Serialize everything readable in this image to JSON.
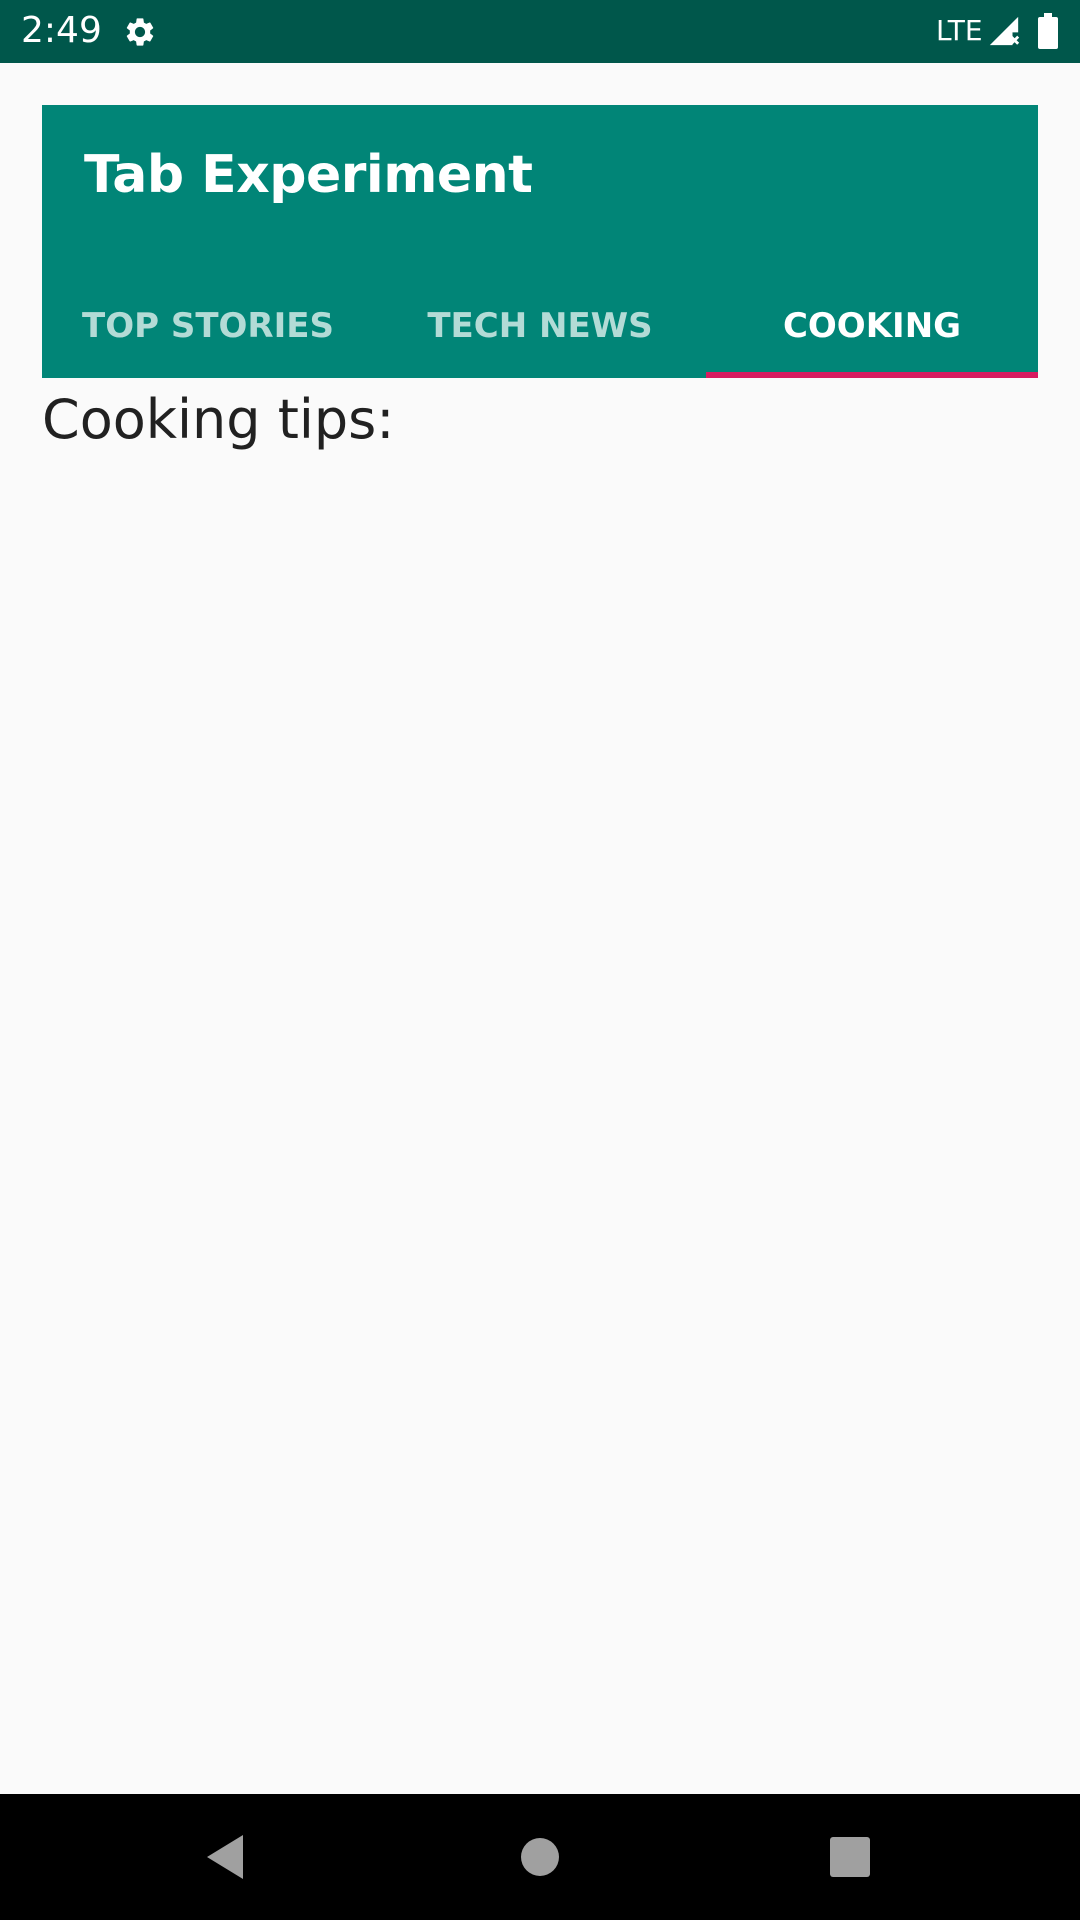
{
  "status_bar": {
    "time": "2:49",
    "network": "LTE",
    "settings_icon": "gear-icon",
    "signal_icon": "signal-icon",
    "battery_icon": "battery-icon"
  },
  "app_bar": {
    "title": "Tab Experiment",
    "tabs": [
      {
        "label": "TOP STORIES",
        "selected": false
      },
      {
        "label": "TECH NEWS",
        "selected": false
      },
      {
        "label": "COOKING",
        "selected": true
      }
    ]
  },
  "content": {
    "text": "Cooking tips:"
  },
  "nav_bar": {
    "back_icon": "back-icon",
    "home_icon": "home-icon",
    "recents_icon": "recents-icon"
  },
  "colors": {
    "primary": "#018577",
    "primary_dark": "#00574b",
    "accent": "#d81b60"
  }
}
